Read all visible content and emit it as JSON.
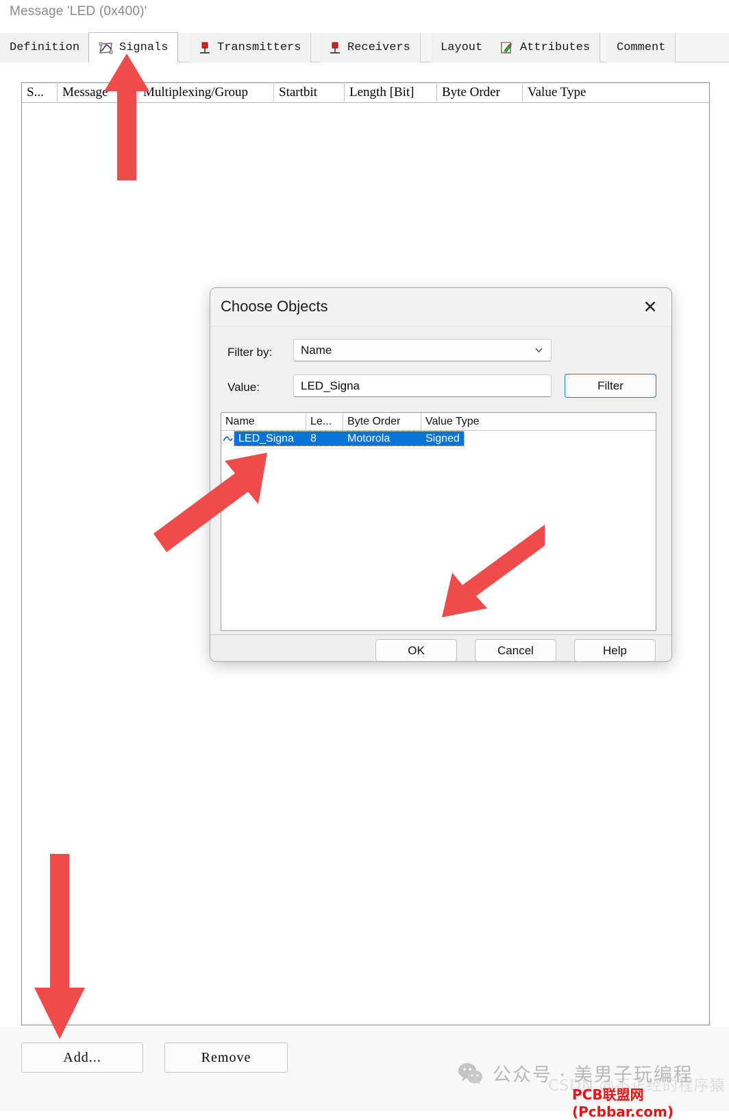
{
  "window": {
    "title": "Message 'LED (0x400)'"
  },
  "tabs": [
    {
      "label": "Definition",
      "icon": "none",
      "active": false
    },
    {
      "label": "Signals",
      "icon": "signal-icon",
      "active": true
    },
    {
      "label": "Transmitters",
      "icon": "transmitter-icon",
      "active": false
    },
    {
      "label": "Receivers",
      "icon": "receiver-icon",
      "active": false
    },
    {
      "label": "Layout",
      "icon": "none",
      "active": false
    },
    {
      "label": "Attributes",
      "icon": "notepad-pencil-icon",
      "active": false
    },
    {
      "label": "Comment",
      "icon": "none",
      "active": false
    }
  ],
  "grid": {
    "columns": [
      "S...",
      "Message",
      "Multiplexing/Group",
      "Startbit",
      "Length [Bit]",
      "Byte Order",
      "Value Type"
    ],
    "rows": []
  },
  "bottom": {
    "add_label": "Add...",
    "remove_label": "Remove"
  },
  "dialog": {
    "title": "Choose Objects",
    "close_icon": "✕",
    "filter_by_label": "Filter by:",
    "filter_by_value": "Name",
    "value_label": "Value:",
    "value_text": "LED_Signa",
    "filter_button": "Filter",
    "list": {
      "columns": [
        "Name",
        "Le...",
        "Byte Order",
        "Value Type"
      ],
      "rows": [
        {
          "name": "LED_Signa",
          "length": "8",
          "byte_order": "Motorola",
          "value_type": "Signed",
          "selected": true,
          "icon": "waveform-icon"
        }
      ]
    },
    "buttons": {
      "ok": "OK",
      "cancel": "Cancel",
      "help": "Help"
    }
  },
  "watermarks": {
    "wechat_text": "公众号 · 美男子玩编程",
    "csdn_text": "CSDN @不正经的程序猿",
    "pcbbar_text": "PCB联盟网(Pcbbar.com)"
  },
  "colors": {
    "accent_blue": "#0a73d6",
    "focus_blue": "#1b7fd4",
    "annotation_red": "#ef4b4b",
    "watermark_red": "#e81313"
  }
}
